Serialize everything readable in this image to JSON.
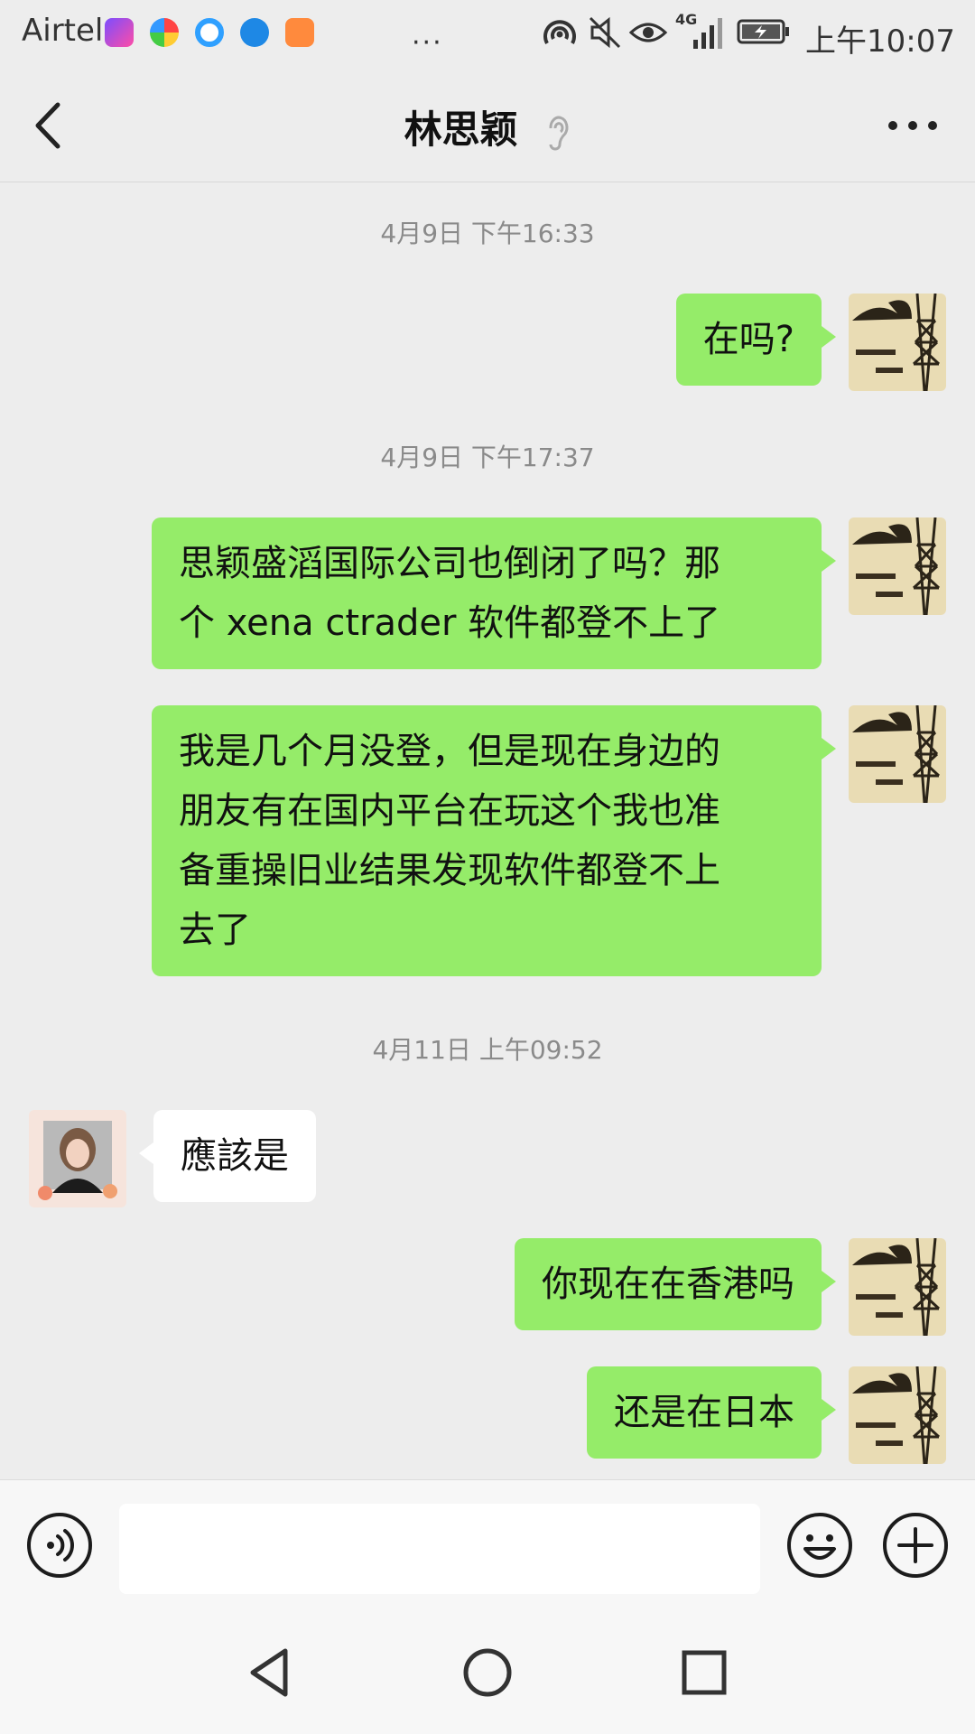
{
  "status_bar": {
    "carrier": "Airtel",
    "more": "···",
    "network": "4G",
    "time": "上午10:07"
  },
  "header": {
    "title": "林思颖",
    "icons": [
      "back-arrow-icon",
      "ear-icon",
      "more-icon"
    ]
  },
  "messages": [
    {
      "type": "timestamp",
      "text": "4月9日 下午16:33"
    },
    {
      "type": "outgoing",
      "lines": [
        "在吗?"
      ]
    },
    {
      "type": "timestamp",
      "text": "4月9日 下午17:37"
    },
    {
      "type": "outgoing",
      "lines": [
        "思颖盛滔国际公司也倒闭了吗？那",
        "个 xena ctrader 软件都登不上了"
      ]
    },
    {
      "type": "outgoing",
      "lines": [
        "我是几个月没登，但是现在身边的",
        "朋友有在国内平台在玩这个我也准",
        "备重操旧业结果发现软件都登不上",
        "去了"
      ]
    },
    {
      "type": "timestamp",
      "text": "4月11日 上午09:52"
    },
    {
      "type": "incoming",
      "lines": [
        "應該是"
      ]
    },
    {
      "type": "outgoing",
      "lines": [
        "你现在在香港吗"
      ]
    },
    {
      "type": "outgoing",
      "lines": [
        "还是在日本"
      ]
    }
  ],
  "input_bar": {
    "placeholder": "",
    "icons": [
      "voice-icon",
      "emoji-icon",
      "plus-icon"
    ]
  },
  "colors": {
    "background": "#ededed",
    "outgoing_bubble": "#95ec69",
    "incoming_bubble": "#ffffff",
    "timestamp": "#8a8a8a"
  }
}
